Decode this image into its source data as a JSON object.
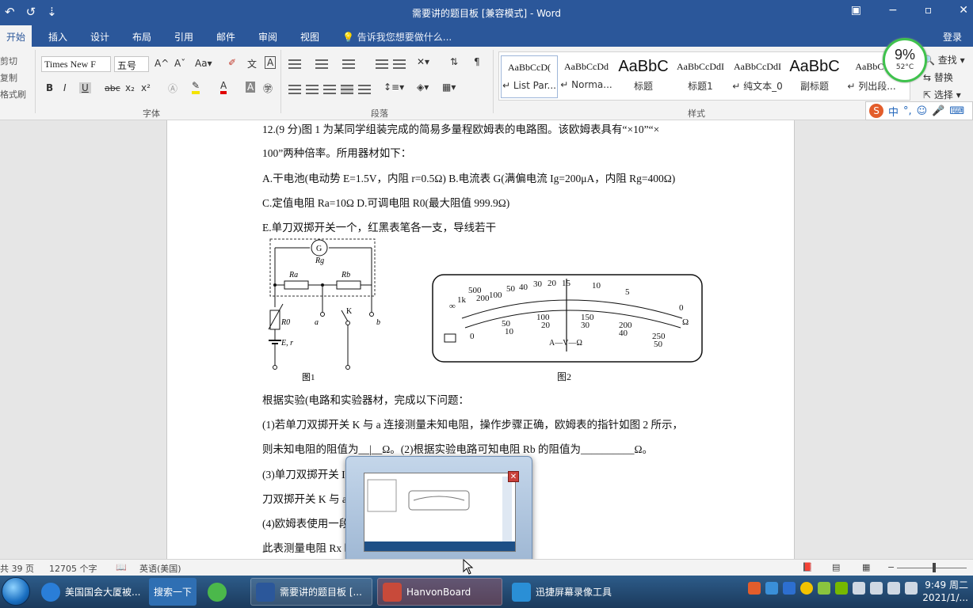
{
  "title_bar": {
    "title": "需要讲的题目板 [兼容模式] - Word",
    "qat": [
      "↶",
      "↺",
      "⇣"
    ],
    "window_buttons": [
      "▣",
      "−",
      "▫",
      "✕"
    ]
  },
  "tabs": [
    "开始",
    "插入",
    "设计",
    "布局",
    "引用",
    "邮件",
    "审阅",
    "视图"
  ],
  "tell_me": "告诉我您想要做什么...",
  "login": "登录",
  "clipboard": [
    "剪切",
    "复制",
    "格式刷"
  ],
  "font": {
    "name": "Times New F",
    "size": "五号",
    "group_label": "字体",
    "buttons": [
      "A^",
      "Aˇ",
      "Aa▾",
      "B",
      "I",
      "U",
      "abc",
      "x₂",
      "x²",
      "A",
      "A"
    ]
  },
  "paragraph": {
    "group_label": "段落"
  },
  "styles": {
    "group_label": "样式",
    "items": [
      {
        "preview": "AaBbCcD(",
        "name": "↵ List Par...",
        "big": false
      },
      {
        "preview": "AaBbCcDd",
        "name": "↵ Norma...",
        "big": false
      },
      {
        "preview": "AaBbC",
        "name": "标题",
        "big": true
      },
      {
        "preview": "AaBbCcDdI",
        "name": "标题1",
        "big": false
      },
      {
        "preview": "AaBbCcDdI",
        "name": "↵ 纯文本_0",
        "big": false
      },
      {
        "preview": "AaBbC",
        "name": "副标题",
        "big": true
      },
      {
        "preview": "AaBbCc",
        "name": "↵ 列出段...",
        "big": false
      }
    ]
  },
  "editing": [
    "查找 ▾",
    "替换",
    "选择 ▾"
  ],
  "perf_widget": {
    "percent": "9%",
    "temp": "52°C"
  },
  "ime": {
    "logo": "S",
    "items": [
      "中",
      "°,",
      "☺",
      "🎤",
      "⌨"
    ]
  },
  "document": {
    "lines": [
      "12.(9 分)图 1 为某同学组装完成的简易多量程欧姆表的电路图。该欧姆表具有“×10”“×",
      "100”两种倍率。所用器材如下：",
      "A.干电池(电动势 E=1.5V，内阻 r=0.5Ω)        B.电流表 G(满偏电流 Ig=200μA，内阻 Rg=400Ω)",
      "C.定值电阻 Ra=10Ω        D.可调电阻 R0(最大阻值 999.9Ω)",
      "E.单刀双掷开关一个，红黑表笔各一支，导线若干",
      "根据实验(电路和实验器材，完成以下问题：",
      "(1)若单刀双掷开关 K 与 a 连接测量未知电阻，操作步骤正确，欧姆表的指针如图 2 所示，",
      "则未知电阻的阻值为__|__Ω。(2)根据实验电路可知电阻 Rb 的阻值为__________Ω。",
      "(3)单刀双掷开关 I                                                    入电路的阻值为__________Ω。单",
      "刀双掷开关 K 与 a                                                    路的阻值为__________Ω。",
      "(4)欧姆表使用一段                                                    ，但此表仍能进行欧姆调零。若用",
      "此表测量电阻 Rx 时                                                   ”“偏小”或“不变”)。"
    ],
    "fig1": {
      "caption": "图1",
      "labels": [
        "G",
        "Rg",
        "Ra",
        "Rb",
        "R0",
        "a",
        "K",
        "b",
        "E, r"
      ]
    },
    "fig2": {
      "caption": "图2",
      "top_scale": [
        "∞",
        "1k",
        "500",
        "200",
        "100",
        "50",
        "40",
        "30",
        "20",
        "15",
        "10",
        "5",
        "0"
      ],
      "bottom_scale": [
        "0",
        "50",
        "10",
        "100",
        "20",
        "150",
        "30",
        "200",
        "40",
        "250",
        "50"
      ],
      "center_label": "A—V—Ω",
      "ohm_label": "Ω"
    }
  },
  "status_bar": {
    "pages": "共 39 页",
    "words": "12705 个字",
    "language": "英语(美国)"
  },
  "popup": {
    "close": "✕"
  },
  "taskbar": {
    "items": [
      {
        "label": "美国国会大厦被...",
        "active": false
      },
      {
        "label": "搜索一下",
        "active": false
      },
      {
        "label": "需要讲的题目板 [...",
        "active": true
      },
      {
        "label": "HanvonBoard",
        "active": true
      },
      {
        "label": "迅捷屏幕录像工具",
        "active": false
      }
    ],
    "clock_time": "9:49 周二",
    "clock_date": "2021/1/..."
  }
}
